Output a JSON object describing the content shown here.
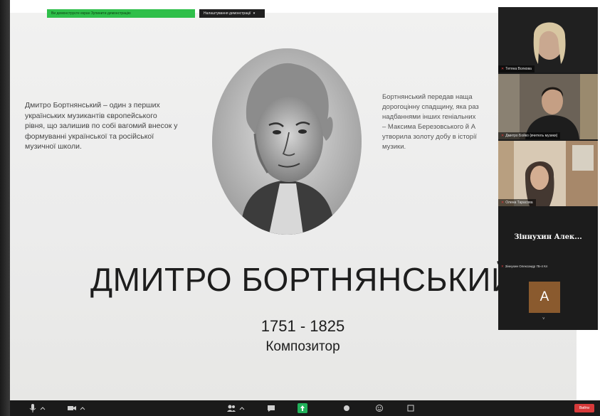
{
  "share": {
    "banner": "Ви демонструєте екран Зупинити демонстрацію",
    "options_label": "Налаштування демонстрації",
    "options_chevron": "▾"
  },
  "slide": {
    "left_text": [
      "Дмитро Бортнянський – один з перших",
      "українських музикантів європейського",
      "рівня, що залишив по собі вагомий внесок у",
      "формуванні української та російської",
      "музичної школи."
    ],
    "right_text": [
      "Бортнянський передав наща",
      "дорогоцінну спадщину, яка раз",
      "надбаннями інших геніальних",
      "– Максима Березовського й А",
      "утворила золоту добу в історії",
      "музики."
    ],
    "title": "ДМИТРО БОРТНЯНСЬКИЙ",
    "years": "1751 - 1825",
    "role": "Композитор"
  },
  "participants": {
    "p1_name": "Тетяна Волкова",
    "p2_name": "Дмитро Бойко (вчитель музики)",
    "p3_name": "Олена Тарасова",
    "p4_big": "Зіннухин Алек...",
    "p4_name": "Зіннухин Олександр 7Б-4 Кл",
    "p5_initial": "A",
    "chevron": "˅"
  },
  "toolbar": {
    "leave": "Вийти"
  },
  "colors": {
    "share_green": "#2fbf4a",
    "leave_red": "#d63a3a",
    "avatar_brown": "#8a5a2e"
  }
}
